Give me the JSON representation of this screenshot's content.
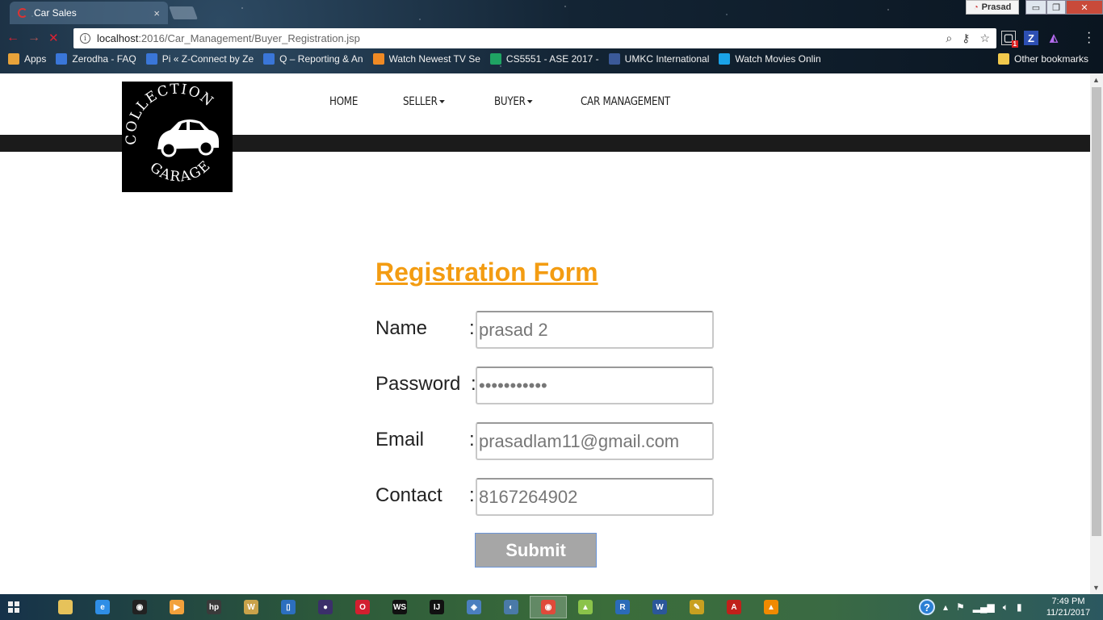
{
  "browser": {
    "tab_title": "Car Sales",
    "tab_close": "×",
    "profile_name": "Prasad",
    "window_controls": {
      "minimize": "▭",
      "maximize": "❐",
      "close": "✕"
    },
    "url_host": "localhost",
    "url_path": ":2016/Car_Management/Buyer_Registration.jsp",
    "omnibox_icons": [
      "zoom-icon",
      "key-icon",
      "star-icon"
    ],
    "extension_badge": "1",
    "extensions": {
      "z_label": "Z"
    },
    "bookmarks": [
      {
        "label": "Apps",
        "icon_color": "#e8a33a"
      },
      {
        "label": "Zerodha - FAQ",
        "icon_color": "#3a76d8"
      },
      {
        "label": "Pi « Z-Connect by Ze",
        "icon_color": "#3a76d8"
      },
      {
        "label": "Q – Reporting & An",
        "icon_color": "#3a76d8"
      },
      {
        "label": "Watch Newest TV Se",
        "icon_color": "#f08a24"
      },
      {
        "label": "CS5551 - ASE 2017 -",
        "icon_color": "#1fa463"
      },
      {
        "label": "UMKC International",
        "icon_color": "#3b5998"
      },
      {
        "label": "Watch Movies Onlin",
        "icon_color": "#1aa3e8"
      }
    ],
    "other_bookmarks": "Other bookmarks"
  },
  "site": {
    "logo_top_text": "COLLECTION",
    "logo_bottom_text": "GARAGE",
    "nav": {
      "home": "HOME",
      "seller": "SELLER",
      "buyer": "BUYER",
      "car_management": "CAR MANAGEMENT"
    }
  },
  "form": {
    "title": "Registration Form",
    "colon": ":",
    "name_label": "Name",
    "name_value": "prasad 2",
    "password_label": "Password",
    "password_value": "•••••••••••",
    "email_label": "Email",
    "email_value": "prasadlam11@gmail.com",
    "contact_label": "Contact",
    "contact_value": "8167264902",
    "submit_label": "Submit"
  },
  "taskbar": {
    "clock_time": "7:49 PM",
    "clock_date": "11/21/2017",
    "help": "?",
    "apps": [
      {
        "name": "file-explorer",
        "color": "#e6c25a",
        "glyph": ""
      },
      {
        "name": "internet-explorer",
        "color": "#2f8ee6",
        "glyph": "e"
      },
      {
        "name": "camera",
        "color": "#222222",
        "glyph": "◉"
      },
      {
        "name": "media-player",
        "color": "#f2a13b",
        "glyph": "▶"
      },
      {
        "name": "hp",
        "color": "#3a3a3a",
        "glyph": "hp"
      },
      {
        "name": "word-old",
        "color": "#c9a24a",
        "glyph": "W"
      },
      {
        "name": "pane",
        "color": "#2c6fbf",
        "glyph": "▯"
      },
      {
        "name": "eclipse",
        "color": "#3b2f6a",
        "glyph": "●"
      },
      {
        "name": "opera",
        "color": "#d21f2f",
        "glyph": "O"
      },
      {
        "name": "webstorm",
        "color": "#111111",
        "glyph": "WS"
      },
      {
        "name": "intellij",
        "color": "#111111",
        "glyph": "IJ"
      },
      {
        "name": "cube",
        "color": "#4b7fbf",
        "glyph": "◈"
      },
      {
        "name": "mysql",
        "color": "#4a7aa8",
        "glyph": "◐"
      },
      {
        "name": "chrome",
        "color": "#e04a3a",
        "glyph": "◉"
      },
      {
        "name": "android",
        "color": "#8bc34a",
        "glyph": "▲"
      },
      {
        "name": "r-studio",
        "color": "#2b6bb8",
        "glyph": "R"
      },
      {
        "name": "word",
        "color": "#2b579a",
        "glyph": "W"
      },
      {
        "name": "tool",
        "color": "#c8a020",
        "glyph": "✎"
      },
      {
        "name": "acrobat",
        "color": "#c0201a",
        "glyph": "A"
      },
      {
        "name": "vlc",
        "color": "#f08a00",
        "glyph": "▲"
      }
    ]
  }
}
